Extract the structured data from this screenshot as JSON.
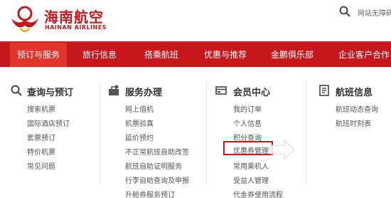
{
  "brand": {
    "name_cn": "海南航空",
    "name_en": "HAINAN AIRLINES"
  },
  "header": {
    "search_label": "网站无障碍"
  },
  "nav": [
    {
      "label": "预订与服务",
      "active": true
    },
    {
      "label": "旅行信息"
    },
    {
      "label": "搭乘航班"
    },
    {
      "label": "优惠与推荐"
    },
    {
      "label": "金鹏俱乐部"
    },
    {
      "label": "企业客户合作"
    }
  ],
  "columns": [
    {
      "title": "查询与预订",
      "icon": "search-icon",
      "links": [
        "搜索机票",
        "国际酒店预订",
        "套票预订",
        "特价机票",
        "常见问题"
      ]
    },
    {
      "title": "服务办理",
      "icon": "service-icon",
      "links": [
        "网上值机",
        "机票验真",
        "延价预约",
        "不正常航班自助改签",
        "航班自助证明服务",
        "行李自助查询及申报",
        "升舱券服务预订"
      ]
    },
    {
      "title": "会员中心",
      "icon": "member-card-icon",
      "links": [
        "我的订单",
        "个人信息",
        "积分查询",
        "优惠券管理",
        "常用乘机人",
        "受益人管理",
        "代金券使用流程"
      ]
    },
    {
      "title": "航班信息",
      "icon": "flight-info-icon",
      "links": [
        "航班动态查询",
        "航班时刻表"
      ]
    }
  ],
  "colors": {
    "brand_red": "#c8161d",
    "active_tab": "#e2342b"
  }
}
